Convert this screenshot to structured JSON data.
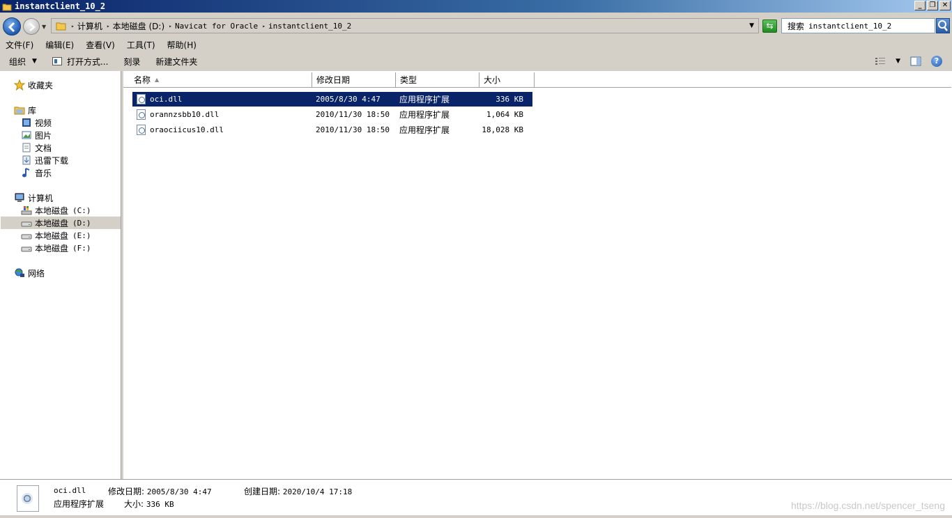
{
  "window": {
    "title": "instantclient_10_2"
  },
  "address": {
    "segments": [
      "计算机",
      "本地磁盘 (D:)",
      "Navicat for Oracle",
      "instantclient_10_2"
    ]
  },
  "search": {
    "label": "搜索",
    "query": "instantclient_10_2"
  },
  "menu": [
    {
      "label": "文件(F)"
    },
    {
      "label": "编辑(E)"
    },
    {
      "label": "查看(V)"
    },
    {
      "label": "工具(T)"
    },
    {
      "label": "帮助(H)"
    }
  ],
  "toolbar": {
    "organize": "组织",
    "open_with": "打开方式...",
    "burn": "刻录",
    "new_folder": "新建文件夹"
  },
  "nav": {
    "favorites": "收藏夹",
    "libraries": "库",
    "library_items": [
      "视频",
      "图片",
      "文档",
      "迅雷下载",
      "音乐"
    ],
    "computer": "计算机",
    "drive_label": "本地磁盘",
    "drives": [
      "(C:)",
      "(D:)",
      "(E:)",
      "(F:)"
    ],
    "network": "网络"
  },
  "columns": {
    "name": "名称",
    "date": "修改日期",
    "type": "类型",
    "size": "大小"
  },
  "files": [
    {
      "name": "oci.dll",
      "date": "2005/8/30 4:47",
      "type": "应用程序扩展",
      "size": "336 KB"
    },
    {
      "name": "orannzsbb10.dll",
      "date": "2010/11/30 18:50",
      "type": "应用程序扩展",
      "size": "1,064 KB"
    },
    {
      "name": "oraociicus10.dll",
      "date": "2010/11/30 18:50",
      "type": "应用程序扩展",
      "size": "18,028 KB"
    }
  ],
  "details": {
    "name": "oci.dll",
    "modified_label": "修改日期:",
    "modified": "2005/8/30 4:47",
    "created_label": "创建日期:",
    "created": "2020/10/4 17:18",
    "type": "应用程序扩展",
    "size_label": "大小:",
    "size": "336 KB"
  },
  "watermark": "https://blog.csdn.net/spencer_tseng"
}
